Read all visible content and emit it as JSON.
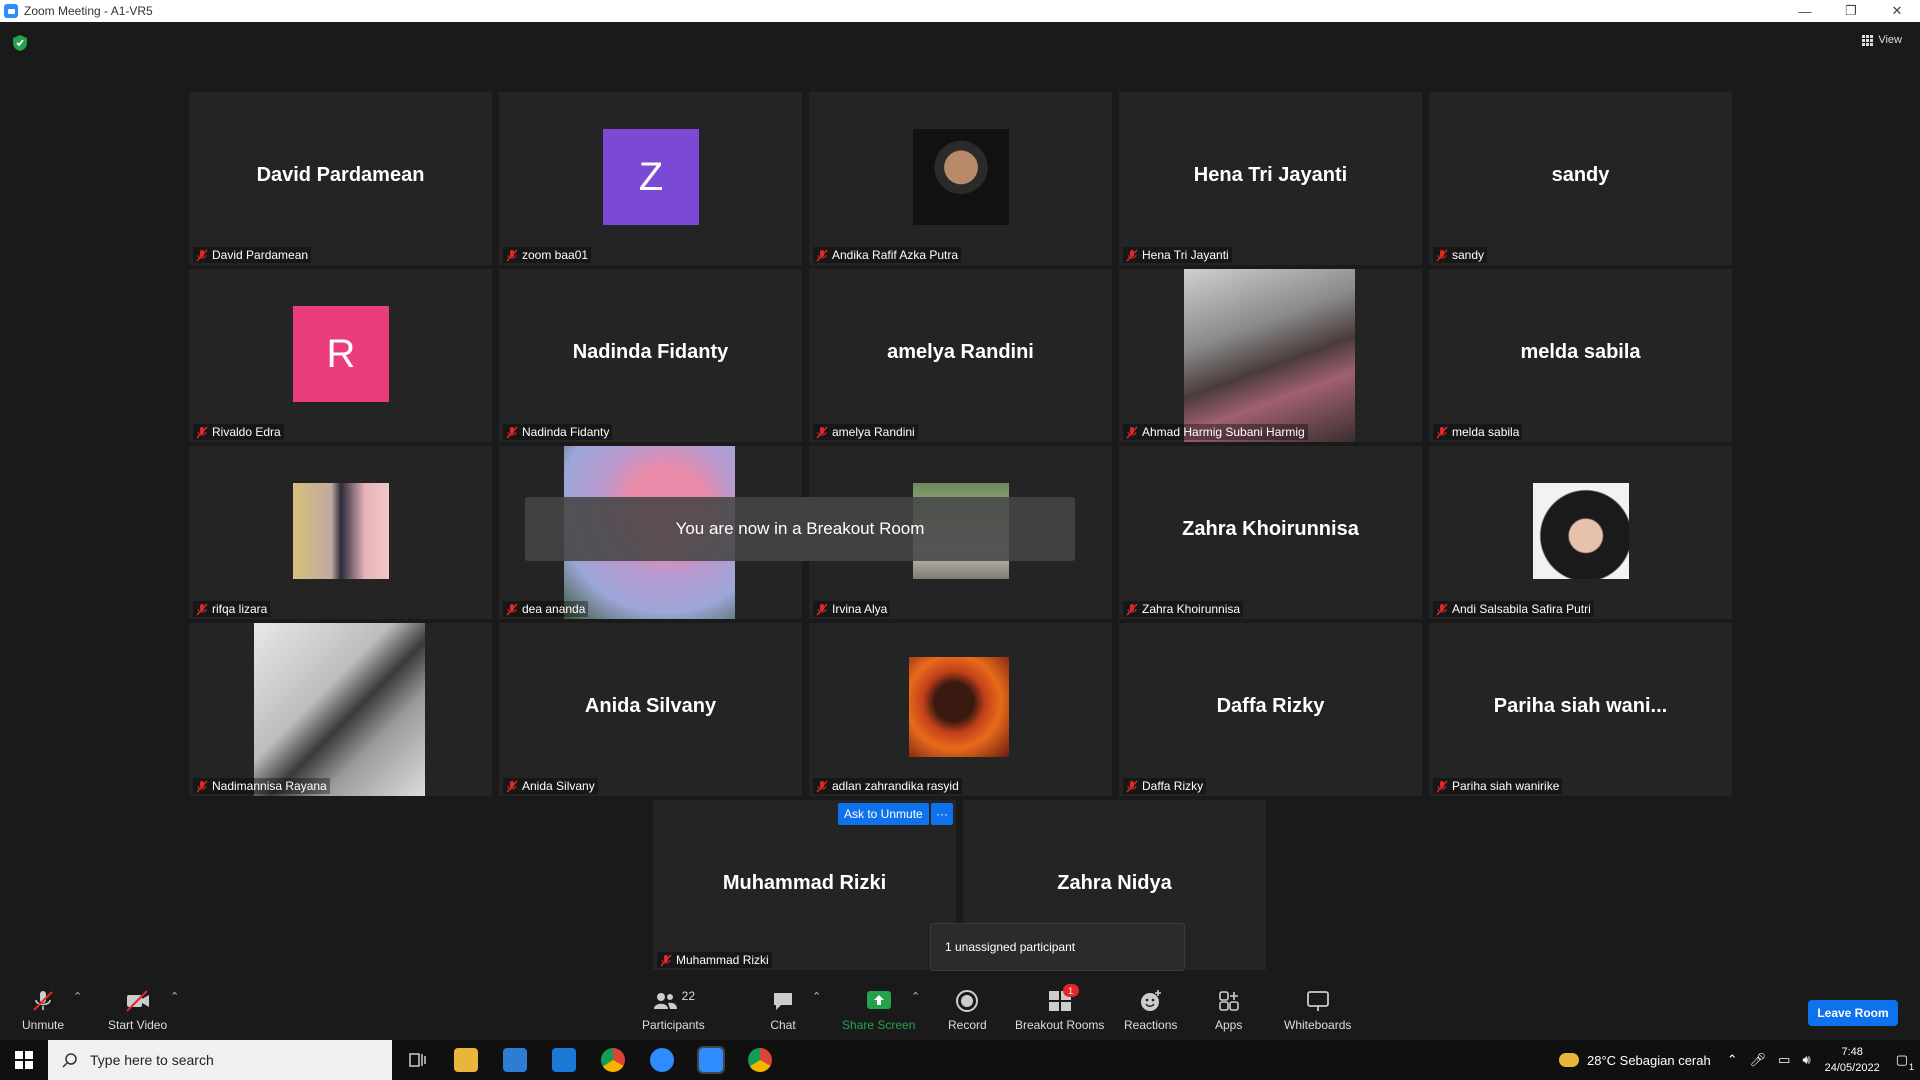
{
  "window": {
    "title": "Zoom Meeting - A1-VR5"
  },
  "controls": {
    "minimize": "—",
    "restore": "❐",
    "close": "✕"
  },
  "view_label": "View",
  "tiles": [
    {
      "name": "David Pardamean",
      "label": "David Pardamean"
    },
    {
      "name": "",
      "label": "zoom baa01",
      "avatar": "Z"
    },
    {
      "name": "",
      "label": "Andika Rafif Azka Putra"
    },
    {
      "name": "Hena Tri Jayanti",
      "label": "Hena Tri Jayanti"
    },
    {
      "name": "sandy",
      "label": "sandy"
    },
    {
      "name": "",
      "label": "Rivaldo Edra",
      "avatar": "R"
    },
    {
      "name": "Nadinda Fidanty",
      "label": "Nadinda Fidanty"
    },
    {
      "name": "amelya Randini",
      "label": "amelya Randini"
    },
    {
      "name": "",
      "label": "Ahmad Harmig Subani Harmig"
    },
    {
      "name": "melda sabila",
      "label": "melda sabila"
    },
    {
      "name": "",
      "label": "rifqa lizara"
    },
    {
      "name": "",
      "label": "dea ananda"
    },
    {
      "name": "",
      "label": "Irvina Alya"
    },
    {
      "name": "Zahra Khoirunnisa",
      "label": "Zahra Khoirunnisa"
    },
    {
      "name": "",
      "label": "Andi Salsabila Safira Putri"
    },
    {
      "name": "",
      "label": "Nadimannisa Rayana"
    },
    {
      "name": "Anida Silvany",
      "label": "Anida Silvany"
    },
    {
      "name": "",
      "label": "adlan zahrandika rasyid"
    },
    {
      "name": "Daffa Rizky",
      "label": "Daffa Rizky"
    },
    {
      "name": "Pariha siah wani...",
      "label": "Pariha siah wanirike"
    },
    {
      "name": "Muhammad Rizki",
      "label": "Muhammad Rizki"
    },
    {
      "name": "Zahra Nidya",
      "label": ""
    }
  ],
  "toast": "You are now in a Breakout Room",
  "ask_unmute": "Ask to Unmute",
  "more": "···",
  "tooltip": "1 unassigned participant",
  "toolbar": {
    "unmute": "Unmute",
    "start_video": "Start Video",
    "participants": "Participants",
    "participants_count": "22",
    "chat": "Chat",
    "share_screen": "Share Screen",
    "record": "Record",
    "breakout_rooms": "Breakout Rooms",
    "breakout_badge": "1",
    "reactions": "Reactions",
    "apps": "Apps",
    "whiteboards": "Whiteboards",
    "leave": "Leave Room"
  },
  "taskbar": {
    "search_placeholder": "Type here to search",
    "weather": "28°C  Sebagian cerah",
    "time": "7:48",
    "date": "24/05/2022",
    "notif_count": "1"
  },
  "colors": {
    "accent": "#0e72ed",
    "avatar_z": "#7b49d3",
    "avatar_r": "#e93e7b",
    "share_green": "#23a24d",
    "mute_red": "#e02828"
  }
}
